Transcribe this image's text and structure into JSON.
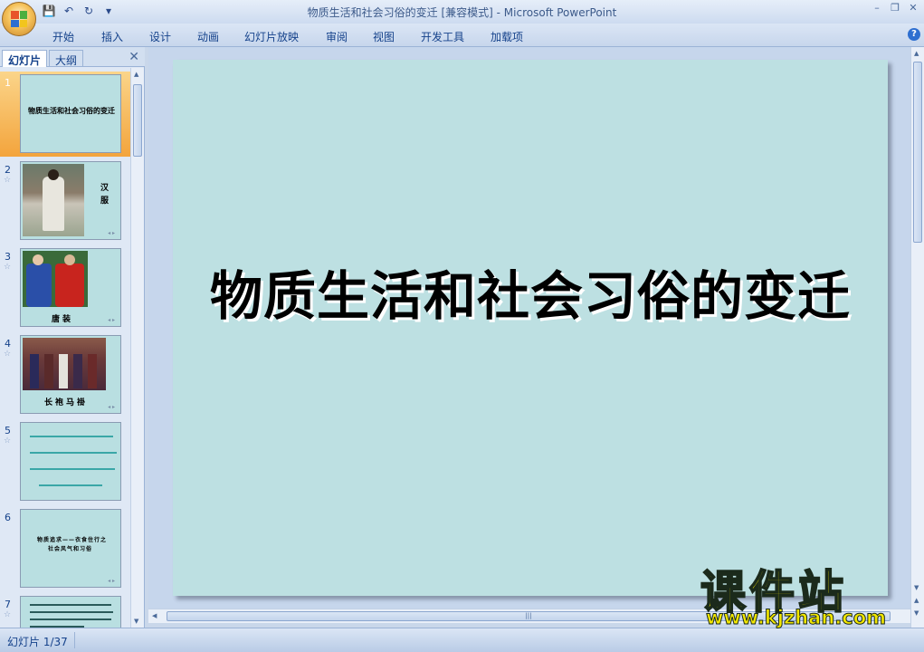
{
  "window": {
    "title": "物质生活和社会习俗的变迁 [兼容模式] - Microsoft PowerPoint",
    "controls": [
      "minimize",
      "restore",
      "close"
    ]
  },
  "quick_access": [
    {
      "icon": "save-icon",
      "glyph": "💾"
    },
    {
      "icon": "undo-icon",
      "glyph": "↶"
    },
    {
      "icon": "redo-icon",
      "glyph": "↻"
    },
    {
      "icon": "customize-icon",
      "glyph": "▾"
    }
  ],
  "ribbon": {
    "tabs": [
      "开始",
      "插入",
      "设计",
      "动画",
      "幻灯片放映",
      "审阅",
      "视图",
      "开发工具",
      "加载项"
    ]
  },
  "left_panel": {
    "tabs": [
      "幻灯片",
      "大纲"
    ],
    "active_tab": "幻灯片",
    "thumbnails": [
      {
        "number": "1",
        "title": "物质生活和社会习俗的变迁",
        "selected": true
      },
      {
        "number": "2",
        "label": "汉服"
      },
      {
        "number": "3",
        "label": "唐装"
      },
      {
        "number": "4",
        "label": "长袍马褂"
      },
      {
        "number": "5"
      },
      {
        "number": "6",
        "lines": [
          "物质追求——衣食住行之",
          "社会风气和习俗"
        ]
      },
      {
        "number": "7"
      }
    ]
  },
  "slide": {
    "title": "物质生活和社会习俗的变迁",
    "background": "#bde0e2"
  },
  "status_bar": {
    "slide_indicator": "幻灯片 1/37"
  },
  "watermark": {
    "text": "课件站",
    "url": "www.kjzhan.com"
  },
  "colors": {
    "accent": "#15428b",
    "selected_thumb": "#f3a43c",
    "slide_bg": "#bde0e2",
    "watermark": "#f2e600"
  }
}
